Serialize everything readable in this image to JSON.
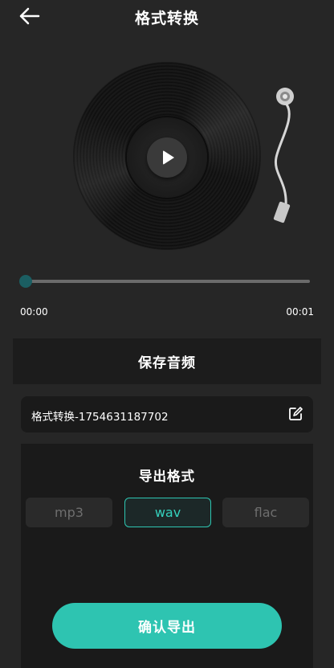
{
  "header": {
    "title": "格式转换",
    "back_icon": "arrow-left-icon"
  },
  "player": {
    "play_icon": "play-icon",
    "current_time": "00:00",
    "total_time": "00:01",
    "progress": 0.0,
    "accent_color": "#1b5e62"
  },
  "save_section": {
    "title": "保存音频",
    "filename": "格式转换-1754631187702",
    "edit_icon": "edit-icon"
  },
  "format_section": {
    "title": "导出格式",
    "options": [
      "mp3",
      "wav",
      "flac"
    ],
    "selected": "wav",
    "selected_color": "#2ec6b2"
  },
  "confirm": {
    "label": "确认导出",
    "color": "#2ec4b1"
  }
}
